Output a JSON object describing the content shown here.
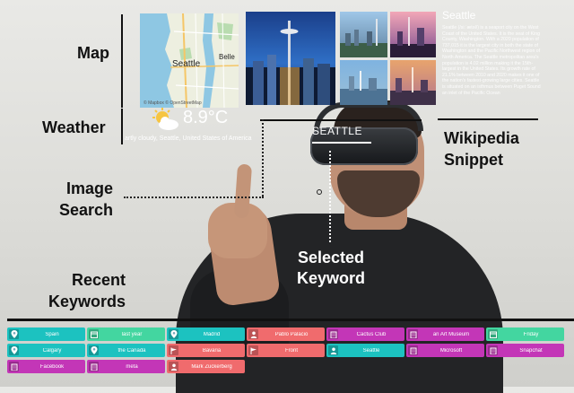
{
  "callouts": {
    "map": "Map",
    "weather": "Weather",
    "image_search_1": "Image",
    "image_search_2": "Search",
    "wikipedia_1": "Wikipedia",
    "wikipedia_2": "Snippet",
    "selected_1": "Selected",
    "selected_2": "Keyword",
    "recent_1": "Recent",
    "recent_2": "Keywords"
  },
  "map": {
    "city_label": "Seattle",
    "partial_label": "Belle",
    "credit": "© Mapbox © OpenStreetMap"
  },
  "weather": {
    "temperature": "8.9°C",
    "description": "artly cloudy, Seattle, United States of America"
  },
  "selected_keyword": "SEATTLE",
  "wikipedia": {
    "title": "Seattle",
    "snippet": "Seattle (/siːˈætəl/) is a seaport city on the West Coast of the United States. It is the seat of King County, Washington. With a 2020 population of 737,015 it is the largest city in both the state of Washington and the Pacific Northwest region of North America. The Seattle metropolitan area's population is 4.02 million making it the 15th-largest in the United States. Its growth rate of 21.1% between 2010 and 2020 makes it one of the nation's fastest-growing large cities. Seattle is situated on an isthmus between Puget Sound an inlet of the Pacific Ocean"
  },
  "colors": {
    "teal": "#1cc2c0",
    "green": "#43d6a0",
    "salmon": "#f06b6d",
    "magenta": "#c336b7"
  },
  "recent_keywords": [
    {
      "label": "Spain",
      "color": "teal",
      "icon": "map-pin-icon"
    },
    {
      "label": "last year",
      "color": "green",
      "icon": "calendar-icon"
    },
    {
      "label": "Madrid",
      "color": "teal",
      "icon": "map-pin-icon"
    },
    {
      "label": "Pablo Palacio",
      "color": "salmon",
      "icon": "person-icon"
    },
    {
      "label": "Cactus Club",
      "color": "magenta",
      "icon": "building-icon"
    },
    {
      "label": "an Art Museum",
      "color": "magenta",
      "icon": "building-icon"
    },
    {
      "label": "Friday",
      "color": "green",
      "icon": "calendar-icon"
    },
    {
      "label": "Calgary",
      "color": "teal",
      "icon": "map-pin-icon"
    },
    {
      "label": "the Canada",
      "color": "teal",
      "icon": "map-pin-icon"
    },
    {
      "label": "Bavaria",
      "color": "salmon",
      "icon": "flag-icon"
    },
    {
      "label": "Front",
      "color": "salmon",
      "icon": "flag-icon"
    },
    {
      "label": "Seattle",
      "color": "teal",
      "icon": "person-icon"
    },
    {
      "label": "Microsoft",
      "color": "magenta",
      "icon": "building-icon"
    },
    {
      "label": "Snapchat",
      "color": "magenta",
      "icon": "building-icon"
    },
    {
      "label": "Facebook",
      "color": "magenta",
      "icon": "building-icon"
    },
    {
      "label": "meta",
      "color": "magenta",
      "icon": "building-icon"
    },
    {
      "label": "Mark Zuckerberg",
      "color": "salmon",
      "icon": "person-icon"
    }
  ]
}
